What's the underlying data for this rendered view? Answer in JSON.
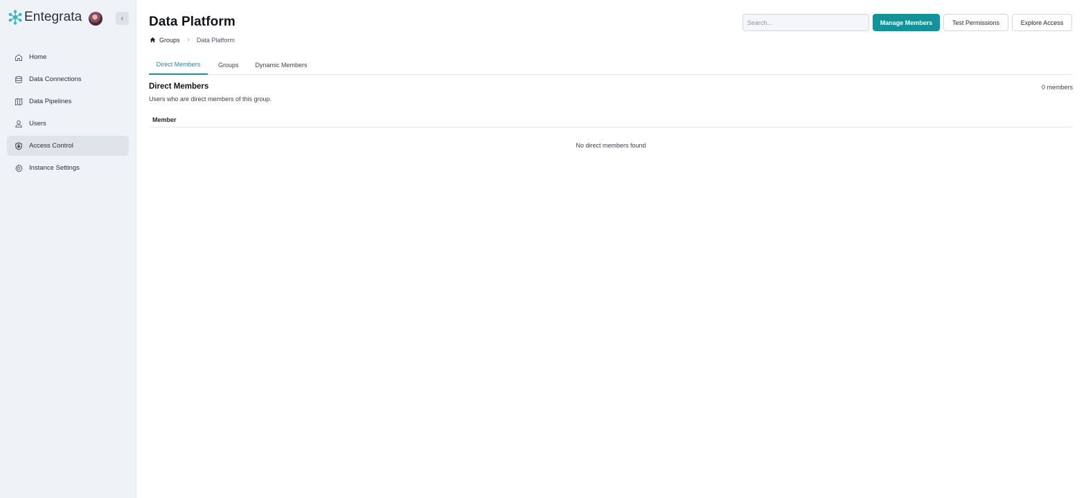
{
  "app": {
    "name": "Entegrata",
    "brand_color": "#2bb5bf",
    "accent_color": "#14929a",
    "collapse_label": "‹"
  },
  "sidebar": {
    "items": [
      {
        "label": "Home",
        "icon": "home-icon",
        "active": false
      },
      {
        "label": "Data Connections",
        "icon": "database-icon",
        "active": false
      },
      {
        "label": "Data Pipelines",
        "icon": "map-icon",
        "active": false
      },
      {
        "label": "Users",
        "icon": "user-icon",
        "active": false
      },
      {
        "label": "Access Control",
        "icon": "shield-lock-icon",
        "active": true
      },
      {
        "label": "Instance Settings",
        "icon": "gear-icon",
        "active": false
      }
    ]
  },
  "header": {
    "title": "Data Platform",
    "search_placeholder": "Search...",
    "buttons": {
      "manage": "Manage Members",
      "test": "Test Permissions",
      "explore": "Explore Access"
    }
  },
  "breadcrumb": {
    "home_icon": "home-icon",
    "groups": "Groups",
    "separator": "›",
    "current": "Data Platform"
  },
  "tabs": [
    {
      "label": "Direct Members",
      "active": true
    },
    {
      "label": "Groups",
      "active": false
    },
    {
      "label": "Dynamic Members",
      "active": false
    }
  ],
  "section": {
    "title": "Direct Members",
    "count": "0 members",
    "description": "Users who are direct members of this group."
  },
  "table": {
    "columns": [
      "Member"
    ],
    "rows": [],
    "empty_message": "No direct members found"
  }
}
